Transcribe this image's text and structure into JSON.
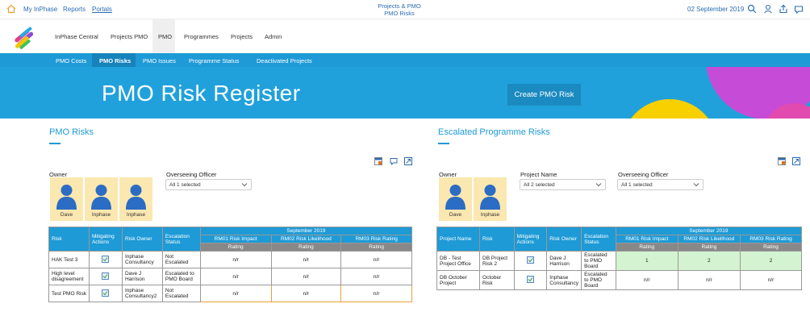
{
  "topbar": {
    "links": [
      "My InPhase",
      "Reports",
      "Portals"
    ],
    "center_line1": "Projects & PMO",
    "center_line2": "PMO Risks",
    "date": "02 September 2019"
  },
  "nav": {
    "items": [
      "InPhase Central",
      "Projects PMO",
      "PMO",
      "Programmes",
      "Projects",
      "Admin"
    ]
  },
  "subnav": {
    "items": [
      "PMO Costs",
      "PMO Risks",
      "PMO Issues",
      "Programme Status",
      "Deactivated Projects"
    ]
  },
  "hero": {
    "title": "PMO Risk Register",
    "create_button": "Create PMO Risk"
  },
  "left_panel": {
    "title": "PMO Risks",
    "owner_label": "Owner",
    "officer_label": "Overseeing Officer",
    "officer_value": "All 1 selected",
    "owners": [
      "Dave",
      "Inphase",
      "Inphase"
    ],
    "table": {
      "period": "September 2019",
      "headers": [
        "Risk",
        "Mitigating Actions",
        "Risk Owner",
        "Escalation Status"
      ],
      "rating_headers": [
        "RM01 Risk Impact",
        "RM02 Risk Likelihood",
        "RM03 Risk Rating"
      ],
      "sub_header": "Rating",
      "rows": [
        {
          "risk": "HAK Test 3",
          "owner": "Inphase Consultancy",
          "status": "Not Escalated",
          "r1": "n/r",
          "r2": "n/r",
          "r3": "n/r"
        },
        {
          "risk": "High level disagreement",
          "owner": "Dave J Harrison",
          "status": "Escalated to PMO Board",
          "r1": "n/r",
          "r2": "n/r",
          "r3": "n/r"
        },
        {
          "risk": "Test PMO Risk",
          "owner": "Inphase Consultancy2",
          "status": "Not Escalated",
          "r1": "n/r",
          "r2": "n/r",
          "r3": "n/r"
        }
      ]
    }
  },
  "right_panel": {
    "title": "Escalated Programme Risks",
    "owner_label": "Owner",
    "project_label": "Project Name",
    "project_value": "All 2 selected",
    "officer_label": "Overseeing Officer",
    "officer_value": "All 1 selected",
    "owners": [
      "Dave",
      "Inphase"
    ],
    "table": {
      "period": "September 2019",
      "headers": [
        "Project Name",
        "Risk",
        "Mitigating Actions",
        "Risk Owner",
        "Escalation Status"
      ],
      "rating_headers": [
        "RM01 Risk Impact",
        "RM02 Risk Likelihood",
        "RM03 Risk Rating"
      ],
      "sub_header": "Rating",
      "rows": [
        {
          "project": "DB - Test Project Office",
          "risk": "DB Project Risk 2",
          "owner": "Dave J Harrison",
          "status": "Escalated to PMO Board",
          "r1": "1",
          "r2": "2",
          "r3": "2"
        },
        {
          "project": "DB October Project",
          "risk": "October Risk",
          "owner": "Inphase Consultancy",
          "status": "Escalated to PMO Board",
          "r1": "n/r",
          "r2": "n/r",
          "r3": "n/r"
        }
      ]
    }
  },
  "colors": {
    "accent": "#1e9ad6",
    "hero": "#21a1db",
    "avatar_bg": "#fbe7b0",
    "green_cell": "#d4f3d0"
  }
}
